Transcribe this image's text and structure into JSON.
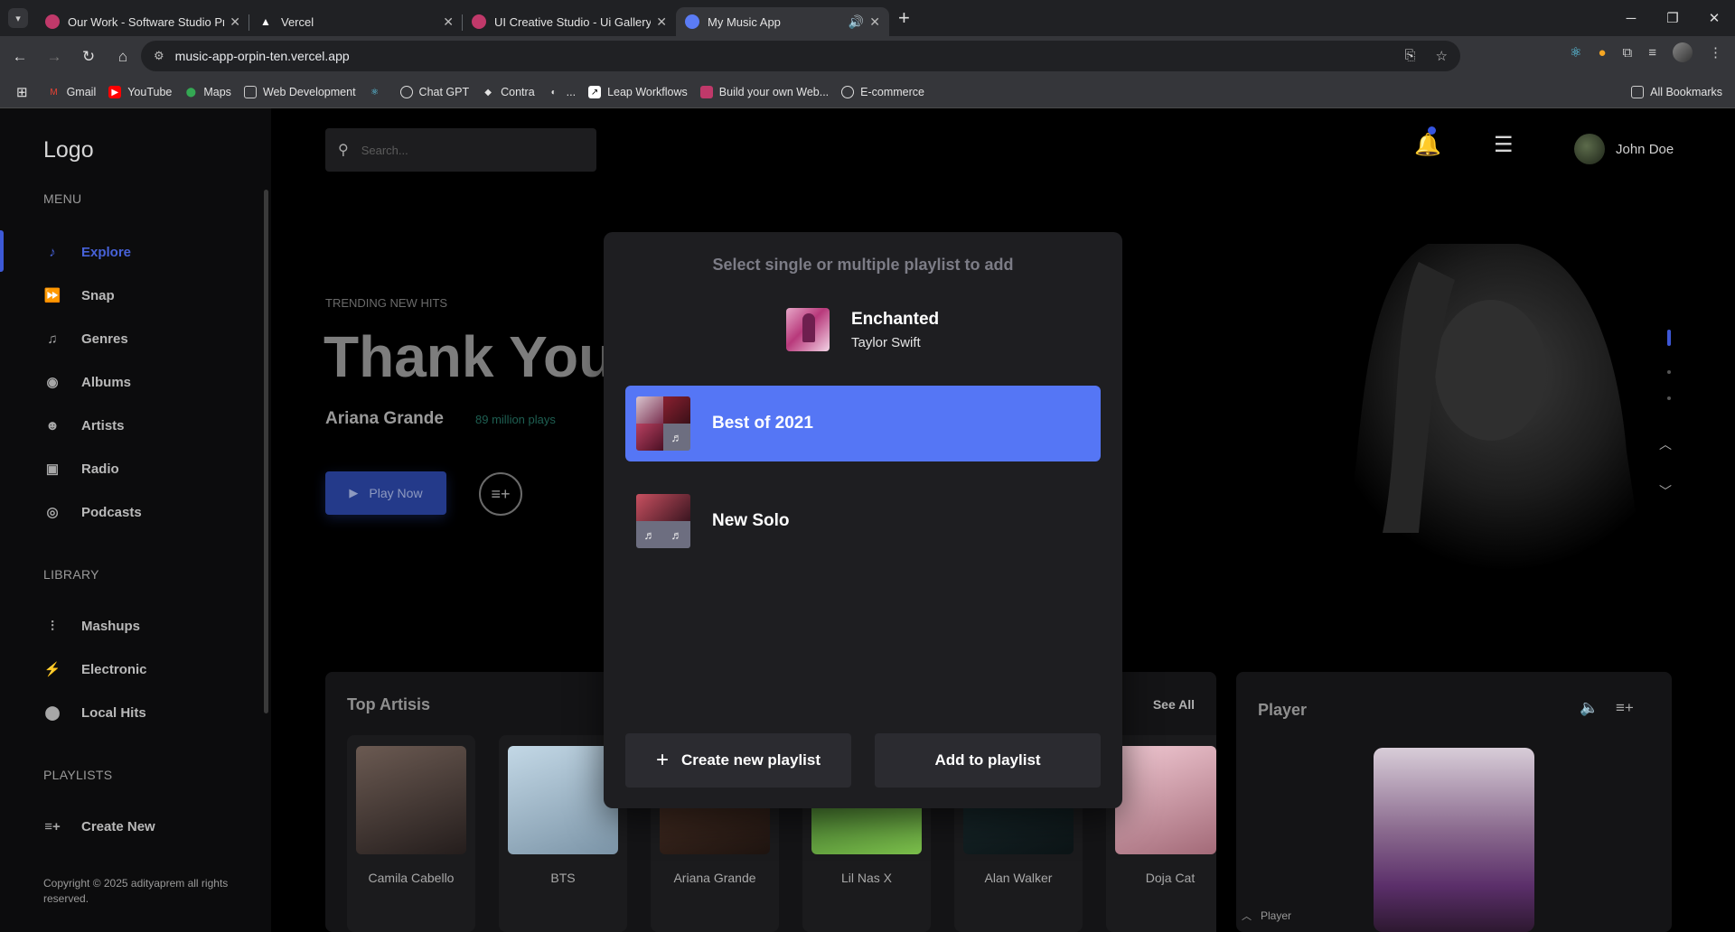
{
  "browser": {
    "tabs": [
      {
        "title": "Our Work - Software Studio Pro",
        "color": "#c0396a"
      },
      {
        "title": "Vercel",
        "color": "#ffffff"
      },
      {
        "title": "UI Creative Studio - Ui Gallery",
        "color": "#c0396a"
      },
      {
        "title": "My Music App",
        "color": "#5b7cf5"
      }
    ],
    "url": "music-app-orpin-ten.vercel.app",
    "bookmarks": [
      {
        "label": "Gmail",
        "icon": "gmail-icon",
        "color": "#ea4335"
      },
      {
        "label": "YouTube",
        "icon": "youtube-icon",
        "color": "#ff0000"
      },
      {
        "label": "Maps",
        "icon": "maps-icon",
        "color": "#34a853"
      },
      {
        "label": "Web Development",
        "icon": "folder-icon",
        "color": "#cccccc"
      },
      {
        "label": "",
        "icon": "react-icon",
        "color": "#61dafb"
      },
      {
        "label": "Chat GPT",
        "icon": "chatgpt-icon",
        "color": "#dddddd"
      },
      {
        "label": "Contra",
        "icon": "contra-icon",
        "color": "#dddddd"
      },
      {
        "label": "...",
        "icon": "globe-icon",
        "color": "#dddddd"
      },
      {
        "label": "Leap Workflows",
        "icon": "leap-icon",
        "color": "#dddddd"
      },
      {
        "label": "Build your own Web...",
        "icon": "build-icon",
        "color": "#c0396a"
      },
      {
        "label": "E-commerce",
        "icon": "globe-icon",
        "color": "#dddddd"
      }
    ],
    "all_bookmarks": "All Bookmarks"
  },
  "sidebar": {
    "logo": "Logo",
    "menu_label": "MENU",
    "menu": [
      {
        "label": "Explore",
        "icon": "♪",
        "active": true
      },
      {
        "label": "Snap",
        "icon": "⏩"
      },
      {
        "label": "Genres",
        "icon": "♫"
      },
      {
        "label": "Albums",
        "icon": "◉"
      },
      {
        "label": "Artists",
        "icon": "👥"
      },
      {
        "label": "Radio",
        "icon": "📻"
      },
      {
        "label": "Podcasts",
        "icon": "◎"
      }
    ],
    "library_label": "LIBRARY",
    "library": [
      {
        "label": "Mashups",
        "icon": "⫶"
      },
      {
        "label": "Electronic",
        "icon": "⚡"
      },
      {
        "label": "Local Hits",
        "icon": "📍"
      }
    ],
    "playlists_label": "PLAYLISTS",
    "create_new": "Create New",
    "copyright": "Copyright © 2025 adityaprem all rights reserved."
  },
  "header": {
    "search_placeholder": "Search...",
    "user_name": "John Doe"
  },
  "hero": {
    "eyebrow": "TRENDING NEW HITS",
    "title": "Thank You",
    "artist": "Ariana Grande",
    "plays": "89 million plays",
    "play_button": "Play Now"
  },
  "top_artists": {
    "title": "Top Artisis",
    "see_all": "See All",
    "items": [
      {
        "name": "Camila Cabello",
        "color": "#3a3030"
      },
      {
        "name": "BTS",
        "color": "#9ab7c9"
      },
      {
        "name": "Ariana Grande",
        "color": "#3a241c"
      },
      {
        "name": "Lil Nas X",
        "color": "#4f8d3c"
      },
      {
        "name": "Alan Walker",
        "color": "#14262a"
      },
      {
        "name": "Doja Cat",
        "color": "#c9a0a9"
      }
    ]
  },
  "player": {
    "title": "Player",
    "bottom_label": "Player"
  },
  "modal": {
    "title": "Select single or multiple playlist to add",
    "song": {
      "title": "Enchanted",
      "artist": "Taylor Swift"
    },
    "playlists": [
      {
        "name": "Best of 2021",
        "selected": true
      },
      {
        "name": "New Solo",
        "selected": false
      }
    ],
    "create_button": "Create new playlist",
    "add_button": "Add to playlist",
    "accent": "#5576f5"
  }
}
